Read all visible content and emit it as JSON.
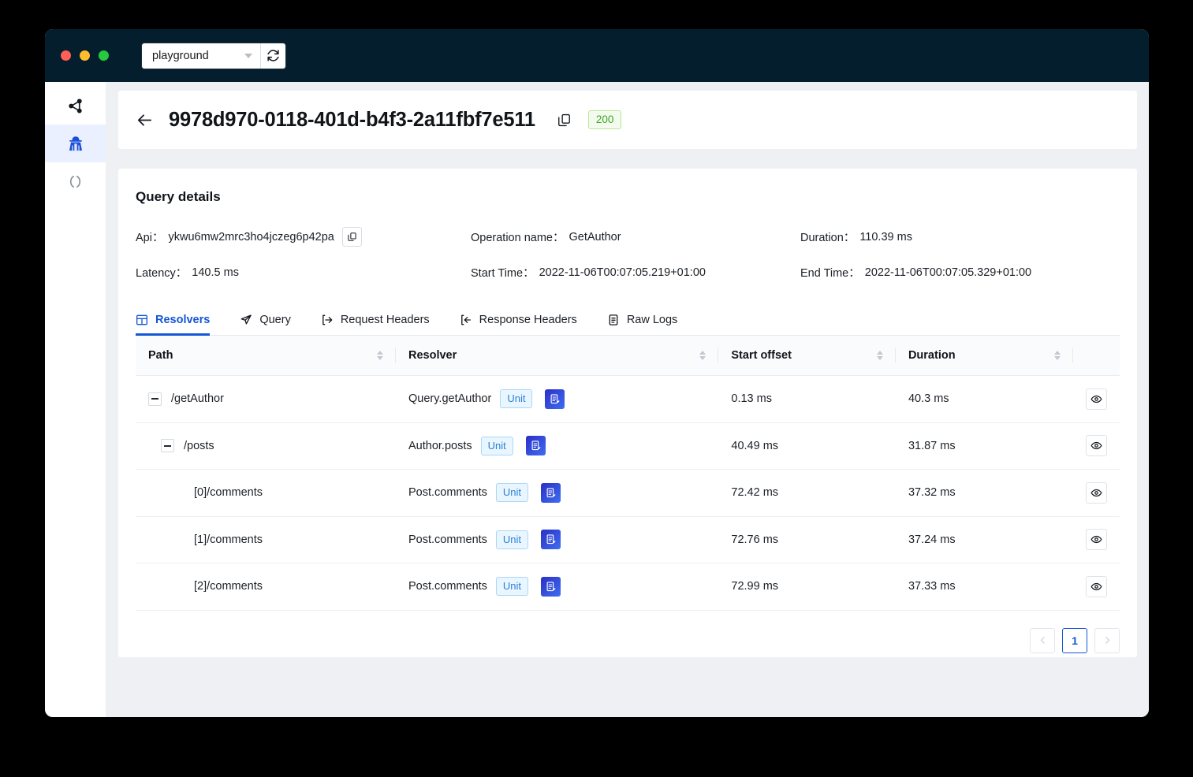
{
  "window": {
    "traffic_lights": [
      "close",
      "minimize",
      "maximize"
    ],
    "env_select": {
      "value": "playground",
      "icon": "chevron-down-icon"
    },
    "refresh_icon": "refresh-icon"
  },
  "sidebar": {
    "items": [
      {
        "icon": "share-network-icon",
        "active": false
      },
      {
        "icon": "detective-icon",
        "active": true
      },
      {
        "icon": "code-brackets-icon",
        "active": false
      }
    ]
  },
  "header": {
    "back_icon": "arrow-left-icon",
    "trace_id": "9978d970-0118-401d-b4f3-2a11fbf7e511",
    "copy_icon": "copy-icon",
    "status": "200",
    "status_color": "#3ba524"
  },
  "details": {
    "title": "Query details",
    "fields": [
      {
        "label": "Api：",
        "value": "ykwu6mw2mrc3ho4jczeg6p42pa",
        "has_copy": true
      },
      {
        "label": "Operation name：",
        "value": "GetAuthor",
        "has_copy": false
      },
      {
        "label": "Duration：",
        "value": "110.39 ms",
        "has_copy": false
      },
      {
        "label": "Latency：",
        "value": "140.5 ms",
        "has_copy": false
      },
      {
        "label": "Start Time：",
        "value": "2022-11-06T00:07:05.219+01:00",
        "has_copy": false
      },
      {
        "label": "End Time：",
        "value": "2022-11-06T00:07:05.329+01:00",
        "has_copy": false
      }
    ]
  },
  "tabs": [
    {
      "label": "Resolvers",
      "icon": "table-grid-icon",
      "active": true
    },
    {
      "label": "Query",
      "icon": "send-paper-plane-icon",
      "active": false
    },
    {
      "label": "Request Headers",
      "icon": "arrow-right-bracket-icon",
      "active": false
    },
    {
      "label": "Response Headers",
      "icon": "arrow-left-bracket-icon",
      "active": false
    },
    {
      "label": "Raw Logs",
      "icon": "file-text-icon",
      "active": false
    }
  ],
  "table": {
    "columns": [
      {
        "label": "Path",
        "sortable": true
      },
      {
        "label": "Resolver",
        "sortable": true
      },
      {
        "label": "Start offset",
        "sortable": true
      },
      {
        "label": "Duration",
        "sortable": true
      },
      {
        "label": "",
        "sortable": false
      }
    ],
    "rows": [
      {
        "indent": 0,
        "expandable": true,
        "toggle_icon": "minus-icon",
        "path": "/getAuthor",
        "resolver": "Query.getAuthor",
        "badge": "Unit",
        "doc_icon": "script-document-icon",
        "start_offset": "0.13 ms",
        "duration": "40.3 ms",
        "eye_icon": "eye-icon"
      },
      {
        "indent": 1,
        "expandable": true,
        "toggle_icon": "minus-icon",
        "path": "/posts",
        "resolver": "Author.posts",
        "badge": "Unit",
        "doc_icon": "script-document-icon",
        "start_offset": "40.49 ms",
        "duration": "31.87 ms",
        "eye_icon": "eye-icon"
      },
      {
        "indent": 2,
        "expandable": false,
        "toggle_icon": "",
        "path": "[0]/comments",
        "resolver": "Post.comments",
        "badge": "Unit",
        "doc_icon": "script-document-icon",
        "start_offset": "72.42 ms",
        "duration": "37.32 ms",
        "eye_icon": "eye-icon"
      },
      {
        "indent": 2,
        "expandable": false,
        "toggle_icon": "",
        "path": "[1]/comments",
        "resolver": "Post.comments",
        "badge": "Unit",
        "doc_icon": "script-document-icon",
        "start_offset": "72.76 ms",
        "duration": "37.24 ms",
        "eye_icon": "eye-icon"
      },
      {
        "indent": 2,
        "expandable": false,
        "toggle_icon": "",
        "path": "[2]/comments",
        "resolver": "Post.comments",
        "badge": "Unit",
        "doc_icon": "script-document-icon",
        "start_offset": "72.99 ms",
        "duration": "37.33 ms",
        "eye_icon": "eye-icon"
      }
    ]
  },
  "pagination": {
    "prev_icon": "chevron-left-icon",
    "next_icon": "chevron-right-icon",
    "pages": [
      "1"
    ],
    "current": "1"
  },
  "colors": {
    "accent": "#1456d6",
    "titlebar": "#041e2e",
    "page_bg": "#eef0f4",
    "success": "#3ba524"
  }
}
